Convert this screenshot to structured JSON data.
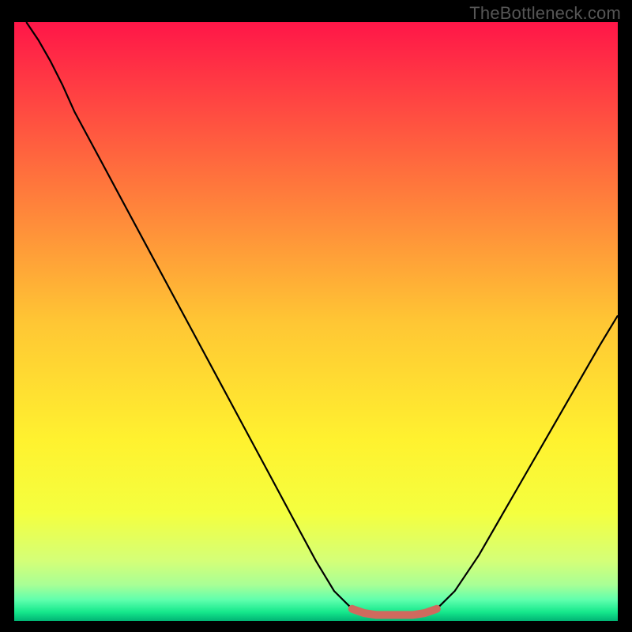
{
  "watermark": "TheBottleneck.com",
  "chart_data": {
    "type": "line",
    "title": "",
    "xlabel": "",
    "ylabel": "",
    "xlim": [
      0,
      100
    ],
    "ylim": [
      0,
      100
    ],
    "grid": false,
    "series": [
      {
        "name": "bottleneck-curve",
        "color": "#000000",
        "points": [
          {
            "x": 2.0,
            "y": 100.0
          },
          {
            "x": 4.0,
            "y": 97.0
          },
          {
            "x": 6.0,
            "y": 93.5
          },
          {
            "x": 8.0,
            "y": 89.5
          },
          {
            "x": 10.0,
            "y": 85.0
          },
          {
            "x": 14.0,
            "y": 77.5
          },
          {
            "x": 18.0,
            "y": 70.0
          },
          {
            "x": 22.0,
            "y": 62.5
          },
          {
            "x": 26.0,
            "y": 55.0
          },
          {
            "x": 30.0,
            "y": 47.5
          },
          {
            "x": 34.0,
            "y": 40.0
          },
          {
            "x": 38.0,
            "y": 32.5
          },
          {
            "x": 42.0,
            "y": 25.0
          },
          {
            "x": 46.0,
            "y": 17.5
          },
          {
            "x": 50.0,
            "y": 10.0
          },
          {
            "x": 53.0,
            "y": 5.0
          },
          {
            "x": 56.0,
            "y": 2.0
          },
          {
            "x": 59.0,
            "y": 1.0
          },
          {
            "x": 63.0,
            "y": 1.0
          },
          {
            "x": 67.0,
            "y": 1.0
          },
          {
            "x": 70.0,
            "y": 2.0
          },
          {
            "x": 73.0,
            "y": 5.0
          },
          {
            "x": 77.0,
            "y": 11.0
          },
          {
            "x": 81.0,
            "y": 18.0
          },
          {
            "x": 85.0,
            "y": 25.0
          },
          {
            "x": 89.0,
            "y": 32.0
          },
          {
            "x": 93.0,
            "y": 39.0
          },
          {
            "x": 97.0,
            "y": 46.0
          },
          {
            "x": 100.0,
            "y": 51.0
          }
        ]
      },
      {
        "name": "sweet-spot-band",
        "color": "#cf6a5e",
        "points": [
          {
            "x": 56.0,
            "y": 2.0
          },
          {
            "x": 58.0,
            "y": 1.3
          },
          {
            "x": 60.0,
            "y": 1.0
          },
          {
            "x": 63.0,
            "y": 1.0
          },
          {
            "x": 66.0,
            "y": 1.0
          },
          {
            "x": 68.0,
            "y": 1.3
          },
          {
            "x": 70.0,
            "y": 2.0
          }
        ]
      }
    ],
    "background": {
      "type": "vertical-gradient",
      "stops": [
        {
          "pos": 0.0,
          "color": "#ff1648"
        },
        {
          "pos": 0.25,
          "color": "#ff6f3d"
        },
        {
          "pos": 0.5,
          "color": "#ffc634"
        },
        {
          "pos": 0.7,
          "color": "#fff22f"
        },
        {
          "pos": 0.82,
          "color": "#f4ff3f"
        },
        {
          "pos": 0.9,
          "color": "#d4ff78"
        },
        {
          "pos": 0.94,
          "color": "#a8ff96"
        },
        {
          "pos": 0.965,
          "color": "#5effad"
        },
        {
          "pos": 0.985,
          "color": "#16e88c"
        },
        {
          "pos": 1.0,
          "color": "#00b574"
        }
      ]
    }
  }
}
